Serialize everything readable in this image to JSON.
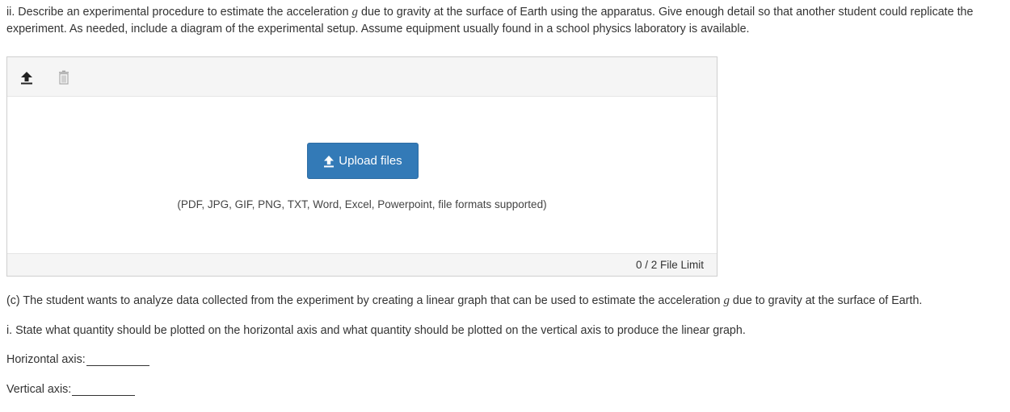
{
  "question_ii": {
    "part1": "ii. Describe an experimental procedure to estimate the acceleration ",
    "symbol": "g",
    "part2": " due to gravity at the surface of Earth using the apparatus. Give enough detail so that another student could replicate the experiment. As needed, include a diagram of the experimental setup. Assume equipment usually found in a school physics laboratory is available."
  },
  "upload": {
    "toolbar_icons": [
      "upload-arrow-icon",
      "trash-icon"
    ],
    "button_label": "Upload files",
    "formats_note": "(PDF, JPG, GIF, PNG, TXT, Word, Excel, Powerpoint, file formats supported)",
    "file_limit": "0 / 2 File Limit",
    "accent_color": "#337ab7"
  },
  "question_c": {
    "part1": "(c) The student wants to analyze data collected from the experiment by creating a linear graph that can be used to estimate the acceleration ",
    "symbol": "g",
    "part2": " due to gravity at the surface of Earth."
  },
  "question_i": {
    "text": "i. State what quantity should be plotted on the horizontal axis and what quantity should be plotted on the vertical axis to produce the linear graph."
  },
  "axes": {
    "horizontal_label": "Horizontal axis:",
    "vertical_label": "Vertical axis:"
  }
}
